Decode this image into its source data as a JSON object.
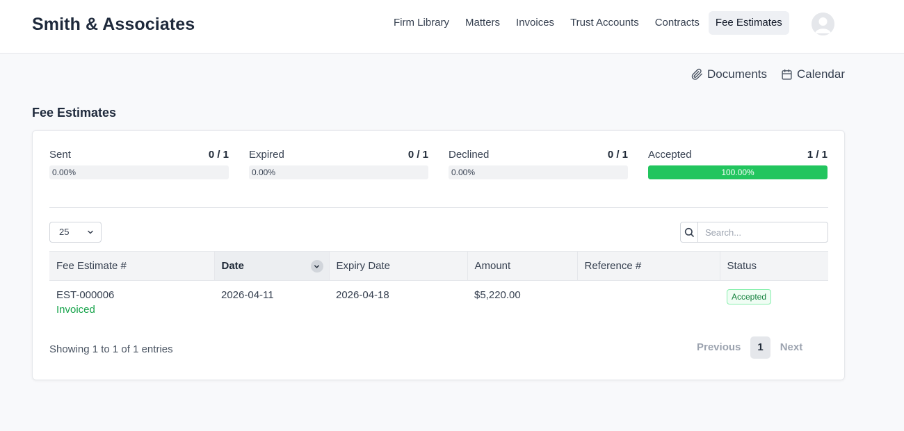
{
  "header": {
    "brand": "Smith & Associates",
    "nav": [
      "Firm Library",
      "Matters",
      "Invoices",
      "Trust Accounts",
      "Contracts",
      "Fee Estimates"
    ],
    "active_nav": "Fee Estimates"
  },
  "quick_links": {
    "documents": "Documents",
    "calendar": "Calendar"
  },
  "page": {
    "title": "Fee Estimates"
  },
  "stats": [
    {
      "label": "Sent",
      "count": "0 / 1",
      "percent_label": "0.00%",
      "fraction": 0
    },
    {
      "label": "Expired",
      "count": "0 / 1",
      "percent_label": "0.00%",
      "fraction": 0
    },
    {
      "label": "Declined",
      "count": "0 / 1",
      "percent_label": "0.00%",
      "fraction": 0
    },
    {
      "label": "Accepted",
      "count": "1 / 1",
      "percent_label": "100.00%",
      "fraction": 1
    }
  ],
  "table_controls": {
    "page_length": "25",
    "search_placeholder": "Search..."
  },
  "table": {
    "columns": [
      "Fee Estimate #",
      "Date",
      "Expiry Date",
      "Amount",
      "Reference #",
      "Status"
    ],
    "sorted_column": "Date",
    "rows": [
      {
        "number": "EST-000006",
        "sub_status": "Invoiced",
        "date": "2026-04-11",
        "expiry": "2026-04-18",
        "amount": "$5,220.00",
        "reference": "",
        "status": "Accepted"
      }
    ]
  },
  "footer": {
    "info": "Showing 1 to 1 of 1 entries",
    "previous": "Previous",
    "page": "1",
    "next": "Next"
  },
  "colors": {
    "accent_green": "#22c55e",
    "status_green": "#16a34a"
  },
  "icons": {
    "documents": "paperclip-icon",
    "calendar": "calendar-icon",
    "search": "search-icon",
    "sort": "chevron-down-icon",
    "select": "chevron-down-icon",
    "avatar": "user-avatar"
  }
}
